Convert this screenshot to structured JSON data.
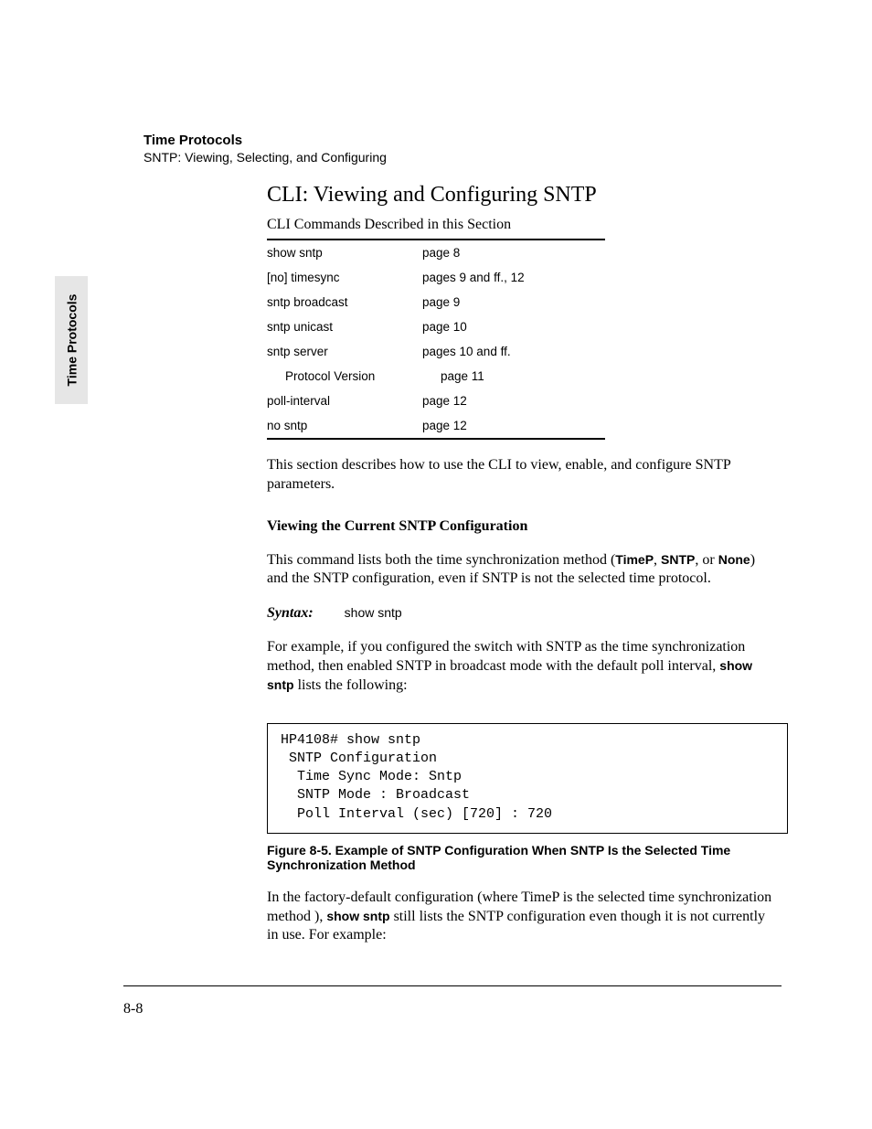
{
  "side_tab": "Time Protocols",
  "header": {
    "title": "Time Protocols",
    "subtitle": "SNTP: Viewing, Selecting, and Configuring"
  },
  "section": {
    "title": "CLI: Viewing and Configuring SNTP",
    "table_caption": "CLI Commands Described in this Section",
    "commands": [
      {
        "cmd": "show sntp",
        "page": "page 8",
        "indent": false
      },
      {
        "cmd": "[no] timesync",
        "page": "pages 9 and ff., 12",
        "indent": false
      },
      {
        "cmd": "sntp broadcast",
        "page": "page 9",
        "indent": false
      },
      {
        "cmd": "sntp unicast",
        "page": "page 10",
        "indent": false
      },
      {
        "cmd": "sntp server",
        "page": "pages 10 and ff.",
        "indent": false
      },
      {
        "cmd": "Protocol Version",
        "page": "page 11",
        "indent": true
      },
      {
        "cmd": "poll-interval",
        "page": "page 12",
        "indent": false
      },
      {
        "cmd": "no sntp",
        "page": "page 12",
        "indent": false
      }
    ],
    "intro_para": "This section describes how to use the CLI to view, enable, and configure SNTP parameters.",
    "subhead": "Viewing the Current SNTP Configuration",
    "desc_para_pre": "This command lists both the time synchronization method (",
    "desc_bold1": "TimeP",
    "desc_sep1": ", ",
    "desc_bold2": "SNTP",
    "desc_sep2": ", or ",
    "desc_bold3": "None",
    "desc_para_post": ") and the SNTP configuration, even if SNTP is not the selected time protocol.",
    "syntax_label": "Syntax:",
    "syntax_cmd": "show sntp",
    "example_para_pre": "For example, if you configured the switch with SNTP as the time synchronization method, then enabled SNTP in broadcast mode with the default poll interval, ",
    "example_bold": "show sntp",
    "example_para_post": " lists the following:",
    "code_block": "HP4108# show sntp\n SNTP Configuration\n  Time Sync Mode: Sntp\n  SNTP Mode : Broadcast\n  Poll Interval (sec) [720] : 720",
    "figure_caption": "Figure 8-5.  Example of SNTP Configuration When SNTP Is the Selected Time Synchronization Method",
    "closing_para_pre": "In the factory-default configuration (where TimeP is the selected time synchronization method ), ",
    "closing_bold": "show sntp",
    "closing_para_post": " still lists the SNTP configuration even though it is not currently in use. For example:"
  },
  "page_number": "8-8"
}
